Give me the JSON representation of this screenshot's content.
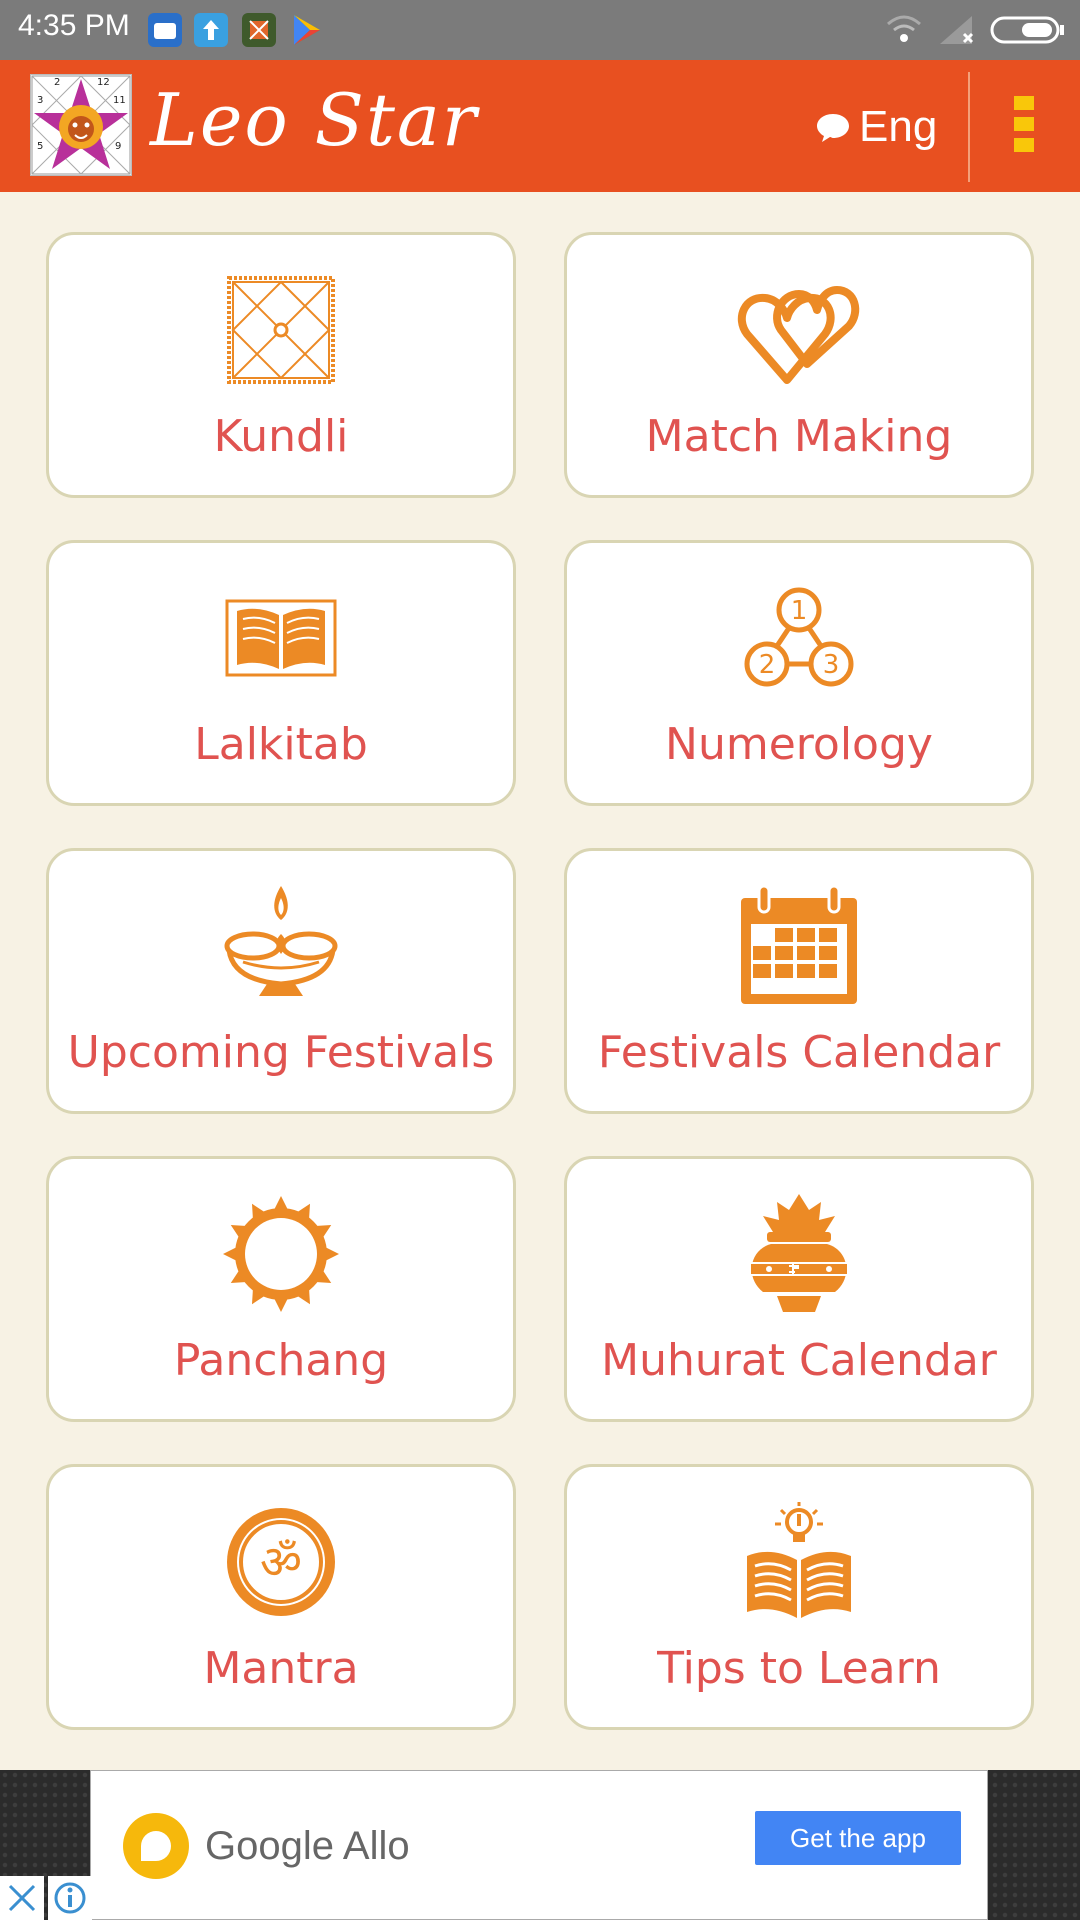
{
  "status_bar": {
    "time": "4:35 PM",
    "icons": [
      "file-explorer-icon",
      "upload-icon",
      "app-icon",
      "play-store-icon",
      "wifi-icon",
      "signal-icon",
      "battery-icon"
    ]
  },
  "app_bar": {
    "title": "Leo Star",
    "language": "Eng",
    "logo_numbers": [
      "2",
      "12",
      "3",
      "11",
      "5",
      "9"
    ]
  },
  "menu": [
    {
      "label": "Kundli",
      "icon": "kundli-chart-icon"
    },
    {
      "label": "Match Making",
      "icon": "two-hearts-icon"
    },
    {
      "label": "Lalkitab",
      "icon": "open-book-icon"
    },
    {
      "label": "Numerology",
      "icon": "numbers-icon",
      "icon_digits": [
        "1",
        "2",
        "3"
      ]
    },
    {
      "label": "Upcoming Festivals",
      "icon": "diya-lamp-icon"
    },
    {
      "label": "Festivals Calendar",
      "icon": "calendar-icon"
    },
    {
      "label": "Panchang",
      "icon": "sun-icon"
    },
    {
      "label": "Muhurat Calendar",
      "icon": "kalash-icon"
    },
    {
      "label": "Mantra",
      "icon": "om-icon",
      "icon_text": "ॐ"
    },
    {
      "label": "Tips to Learn",
      "icon": "book-lightbulb-icon"
    }
  ],
  "ad": {
    "brand": "Google Allo",
    "cta": "Get the app"
  },
  "colors": {
    "app_bar": "#e85020",
    "accent_icon": "#ec8a25",
    "label": "#e05350",
    "background": "#f7f2e4"
  }
}
